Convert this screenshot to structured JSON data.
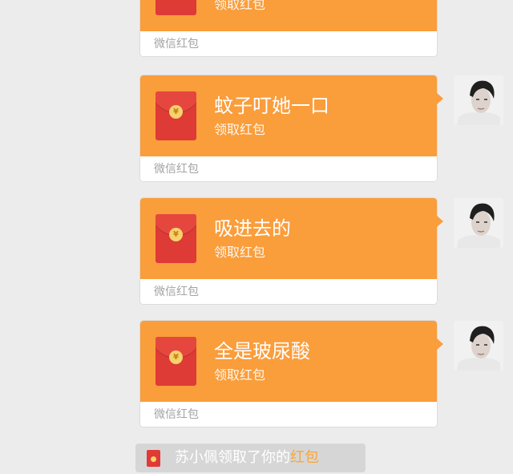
{
  "colors": {
    "page_background": "#ececec",
    "card_orange": "#fa9d3b",
    "envelope_red": "#de3a36",
    "notice_link": "#f7a73d"
  },
  "messages": [
    {
      "title": "",
      "subtitle": "领取红包",
      "footer": "微信红包",
      "avatar": "avatar"
    },
    {
      "title": "蚊子叮她一口",
      "subtitle": "领取红包",
      "footer": "微信红包",
      "avatar": "avatar"
    },
    {
      "title": "吸进去的",
      "subtitle": "领取红包",
      "footer": "微信红包",
      "avatar": "avatar"
    },
    {
      "title": "全是玻尿酸",
      "subtitle": "领取红包",
      "footer": "微信红包",
      "avatar": "avatar"
    }
  ],
  "notice": {
    "text": "苏小佩领取了你的",
    "link": "红包"
  },
  "icons": {
    "envelope": "red-envelope-icon",
    "seal": "coin-seal-icon",
    "avatar": "user-avatar"
  }
}
